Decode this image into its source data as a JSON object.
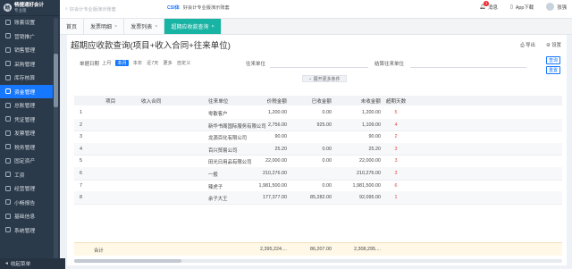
{
  "logo": {
    "name": "畅捷通好会计",
    "edition": "专业版"
  },
  "sidebar": {
    "items": [
      {
        "label": "账套设置",
        "icon": "settings-icon"
      },
      {
        "label": "营销推广",
        "icon": "promotion-icon"
      },
      {
        "label": "销售管理",
        "icon": "sales-icon"
      },
      {
        "label": "采购管理",
        "icon": "purchase-icon"
      },
      {
        "label": "库存核算",
        "icon": "inventory-icon"
      },
      {
        "label": "资金管理",
        "icon": "fund-icon",
        "active": true
      },
      {
        "label": "总账管理",
        "icon": "ledger-icon"
      },
      {
        "label": "凭证管理",
        "icon": "voucher-icon"
      },
      {
        "label": "发票管理",
        "icon": "invoice-icon"
      },
      {
        "label": "税务管理",
        "icon": "tax-icon"
      },
      {
        "label": "固定资产",
        "icon": "asset-icon"
      },
      {
        "label": "工资",
        "icon": "salary-icon"
      },
      {
        "label": "经营管理",
        "icon": "operation-icon"
      },
      {
        "label": "小畅报告",
        "icon": "report-icon"
      },
      {
        "label": "基础信息",
        "icon": "info-icon"
      },
      {
        "label": "系统管理",
        "icon": "system-icon"
      }
    ],
    "collapse_label": "收起菜单"
  },
  "header": {
    "search_placeholder": "好会计专业版演示账套",
    "banner_brand": "CSI体",
    "banner_text": "好会计专业版演示账套",
    "messages_label": "消息",
    "messages_badge": "1",
    "app_label": "App下载",
    "user_label": "张强"
  },
  "tabs": [
    {
      "label": "首页",
      "closable": false
    },
    {
      "label": "发票明细",
      "closable": true
    },
    {
      "label": "发票列表",
      "closable": true
    },
    {
      "label": "超期应收款查询",
      "closable": true,
      "active": true
    }
  ],
  "page": {
    "title": "超期应收款查询(项目+收入合同+往来单位)",
    "export_label": "导出",
    "settings_label": "设置"
  },
  "filters": {
    "date_label": "单据日期",
    "quick_options": [
      "上月",
      "本月",
      "本年",
      "近7天",
      "更多",
      "自定义"
    ],
    "selected_quick": "本月",
    "partner_label": "往来单位",
    "settle_label": "结算往来单位",
    "query_button": "查询",
    "reset_button": "重置",
    "expand_label": "展开更多条件"
  },
  "table": {
    "columns": [
      "",
      "项目",
      "收入合同",
      "往来单位",
      "价税金额",
      "已收金额",
      "未收金额",
      "超期天数"
    ],
    "rows": [
      {
        "no": "1",
        "project": "",
        "contract": "",
        "partner": "零散客户",
        "amount": "1,200.00",
        "received": "0.00",
        "unreceived": "1,200.00",
        "days": "5"
      },
      {
        "no": "2",
        "project": "",
        "contract": "",
        "partner": "新华书阁国际服务有限公司",
        "amount": "2,756.00",
        "received": "925.00",
        "unreceived": "1,109.00",
        "days": "4"
      },
      {
        "no": "3",
        "project": "",
        "contract": "",
        "partner": "龙源百化有限公司",
        "amount": "90.00",
        "received": "",
        "unreceived": "90.00",
        "days": "2"
      },
      {
        "no": "4",
        "project": "",
        "contract": "",
        "partner": "百兴贸易公司",
        "amount": "25.20",
        "received": "0.00",
        "unreceived": "25.20",
        "days": "3"
      },
      {
        "no": "5",
        "project": "",
        "contract": "",
        "partner": "田光日用品有限公司",
        "amount": "22,000.00",
        "received": "0.00",
        "unreceived": "22,000.00",
        "days": "3"
      },
      {
        "no": "6",
        "project": "",
        "contract": "",
        "partner": "一般",
        "amount": "210,276.00",
        "received": "",
        "unreceived": "210,276.00",
        "days": "3"
      },
      {
        "no": "7",
        "project": "",
        "contract": "",
        "partner": "辣虎子",
        "amount": "1,981,500.00",
        "received": "0.00",
        "unreceived": "1,981,500.00",
        "days": "6"
      },
      {
        "no": "8",
        "project": "",
        "contract": "",
        "partner": "余子大王",
        "amount": "177,377.00",
        "received": "85,282.00",
        "unreceived": "92,095.00",
        "days": "1"
      }
    ],
    "total": {
      "label": "合计",
      "amount": "2,395,224....",
      "received": "86,207.00",
      "unreceived": "2,308,295...."
    }
  },
  "colors": {
    "accent": "#1677ff",
    "active_tab": "#17b3a3",
    "sidebar": "#2b3a4a",
    "overdue": "#e64545"
  }
}
